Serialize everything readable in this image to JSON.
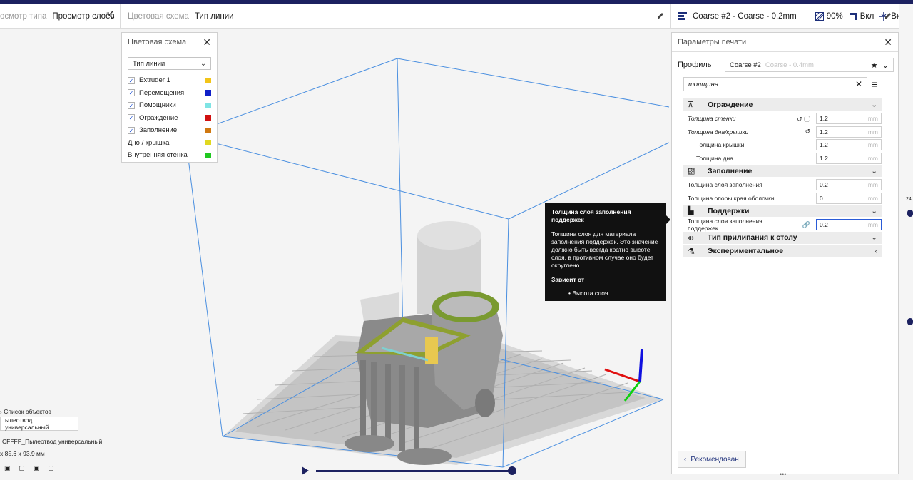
{
  "topbar": {
    "view_type_label": "осмотр типа",
    "view_mode": "Просмотр слоёв",
    "color_scheme_label": "Цветовая схема",
    "color_scheme_value": "Тип линии",
    "profile_summary": "Coarse #2 - Coarse - 0.2mm",
    "infill_percent": "90%",
    "support_state": "Вкл",
    "adhesion_state": "Вкл"
  },
  "color_scheme_panel": {
    "title": "Цветовая схема",
    "selected": "Тип линии",
    "items": [
      {
        "label": "Extruder 1",
        "checked": true,
        "color": "#f2c418"
      },
      {
        "label": "Перемещения",
        "checked": true,
        "color": "#1020c8"
      },
      {
        "label": "Помощники",
        "checked": true,
        "color": "#7fe4e4"
      },
      {
        "label": "Ограждение",
        "checked": true,
        "color": "#d01010"
      },
      {
        "label": "Заполнение",
        "checked": true,
        "color": "#d07810"
      },
      {
        "label": "Дно / крышка",
        "checked": false,
        "color": "#e0d820"
      },
      {
        "label": "Внутренняя стенка",
        "checked": false,
        "color": "#20c820"
      }
    ]
  },
  "print_settings": {
    "title": "Параметры печати",
    "profile_label": "Профиль",
    "profile_name": "Coarse #2",
    "profile_sub": "Coarse - 0.4mm",
    "search_value": "толщина",
    "sections": [
      {
        "title": "Ограждение",
        "rows": [
          {
            "label": "Толщина стенки",
            "value": "1.2",
            "unit": "mm",
            "italic": true,
            "icons": "↺ ⓘ"
          },
          {
            "label": "Толщина дна/крышки",
            "value": "1.2",
            "unit": "mm",
            "italic": true,
            "icons": "↺"
          },
          {
            "label": "Толщина крышки",
            "value": "1.2",
            "unit": "mm",
            "indent": true
          },
          {
            "label": "Толщина дна",
            "value": "1.2",
            "unit": "mm",
            "indent": true
          }
        ]
      },
      {
        "title": "Заполнение",
        "rows": [
          {
            "label": "Толщина слоя заполнения",
            "value": "0.2",
            "unit": "mm"
          },
          {
            "label": "Толщина опоры края оболочки",
            "value": "0",
            "unit": "mm"
          }
        ]
      },
      {
        "title": "Поддержки",
        "rows": [
          {
            "label": "Толщина слоя заполнения поддержек",
            "value": "0.2",
            "unit": "mm",
            "icons": "🔗",
            "active": true
          }
        ]
      },
      {
        "title": "Тип прилипания к столу",
        "rows": []
      },
      {
        "title": "Экспериментальное",
        "rows": []
      }
    ],
    "recommended_button": "Рекомендован"
  },
  "tooltip": {
    "title": "Толщина слоя заполнения поддержек",
    "body": "Толщина слоя для материала заполнения поддержек. Это значение должно быть всегда кратно высоте слоя, в противном случае оно будет округлено.",
    "depends_label": "Зависит от",
    "depends_item": "• Высота слоя"
  },
  "bottom_left": {
    "objects_list": "Список объектов",
    "object_field": "ылеотвод универсальный...",
    "object_name": "CFFFP_Пылеотвод универсальный",
    "dimensions": "x 85.6 x 93.9 мм"
  },
  "side_slider_label": "24"
}
